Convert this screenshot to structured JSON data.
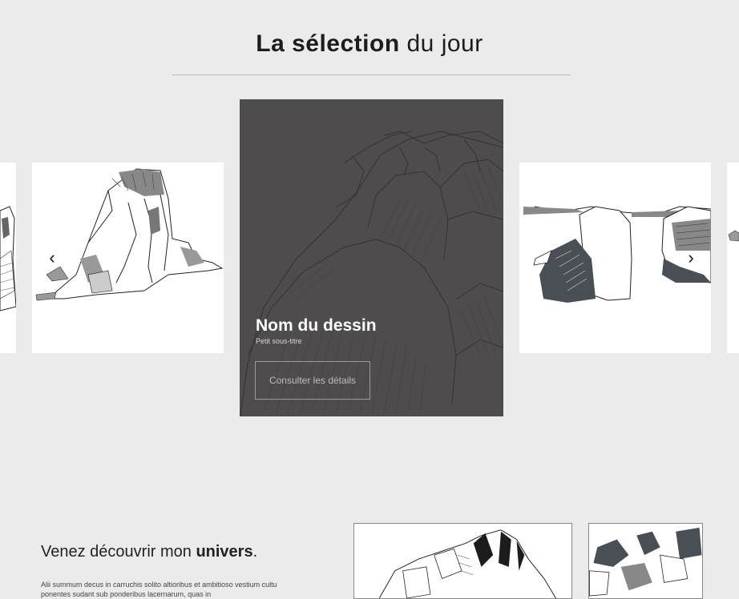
{
  "header": {
    "title_bold": "La sélection",
    "title_rest": " du jour"
  },
  "carousel": {
    "featured": {
      "title": "Nom du dessin",
      "subtitle": "Petit sous-titre",
      "button_label": "Consulter les détails"
    },
    "prev_icon": "‹",
    "next_icon": "›"
  },
  "intro": {
    "title_start": "Venez découvrir mon ",
    "title_bold": "univers",
    "title_end": ".",
    "text": "Alii summum decus in carruchis solito altioribus et ambitioso vestium cultu ponentes sudant sub ponderibus lacernarum, quas in"
  },
  "colors": {
    "background": "#ebebeb",
    "featured_overlay": "#4e4d4d",
    "card": "#ffffff"
  }
}
